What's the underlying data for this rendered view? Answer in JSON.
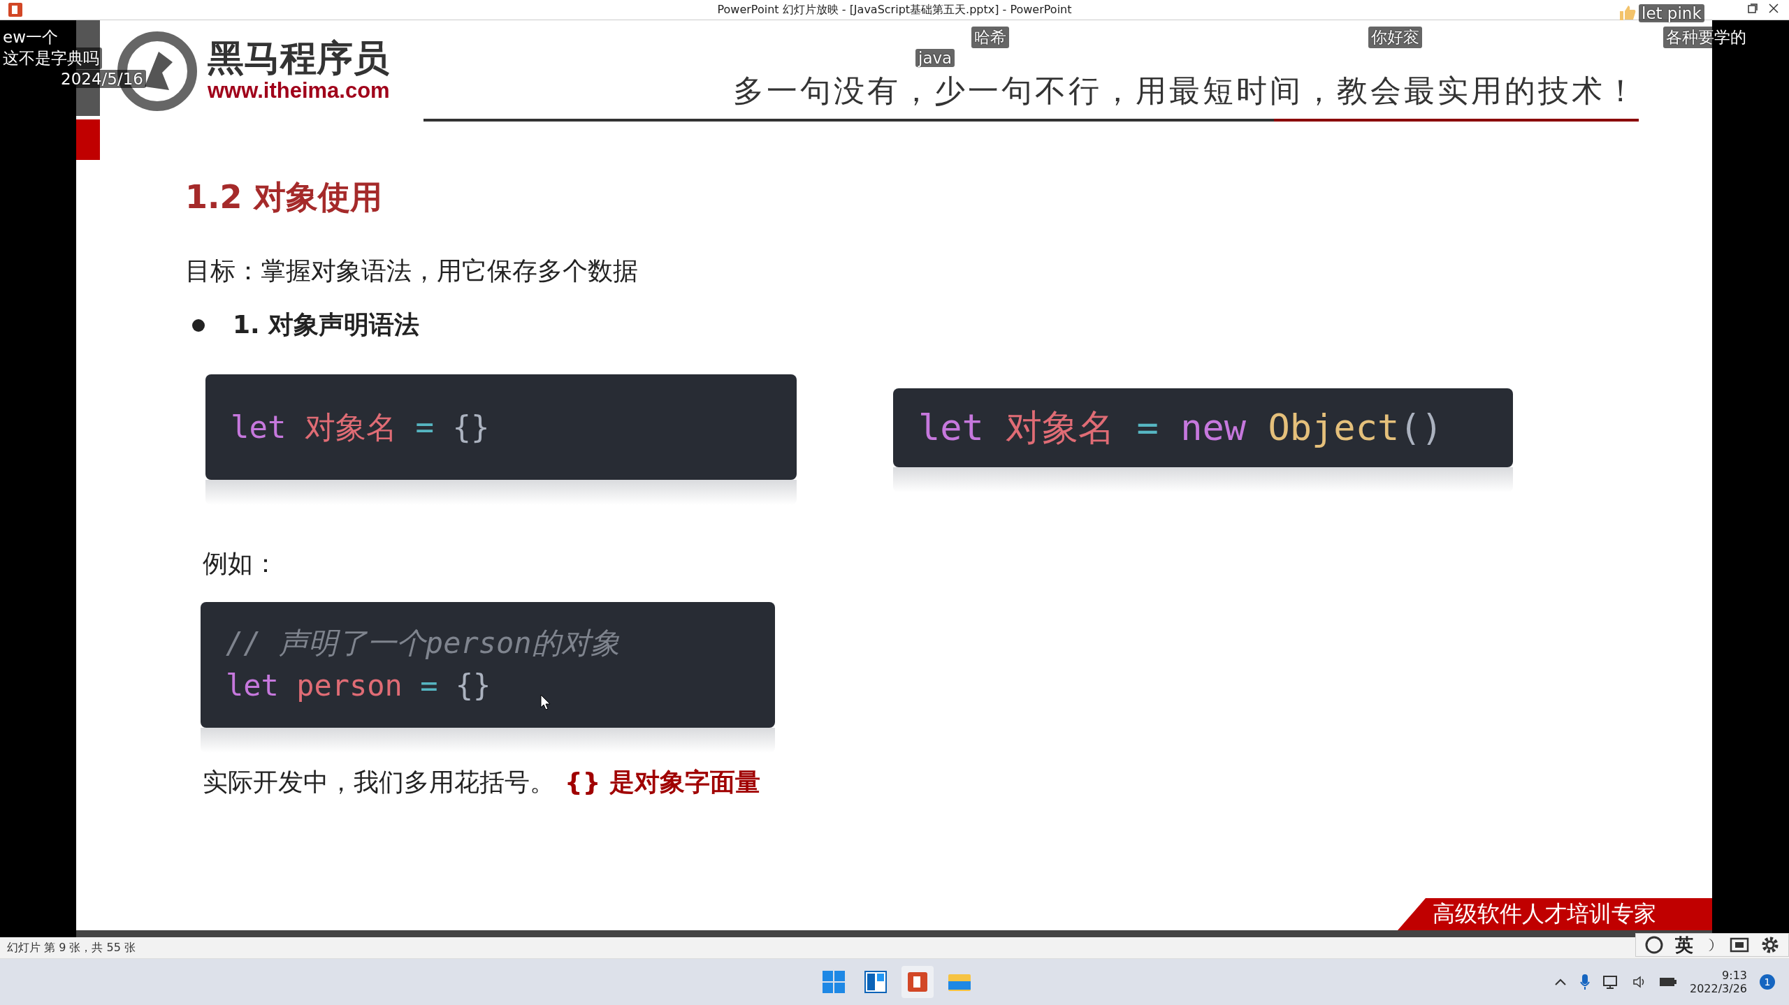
{
  "window": {
    "title": "PowerPoint 幻灯片放映 - [JavaScript基础第五天.pptx] - PowerPoint"
  },
  "danmaku": [
    {
      "text": "ew一个"
    },
    {
      "text": "这不是字典吗"
    },
    {
      "text": "2024/5/16"
    },
    {
      "text": "哈希"
    },
    {
      "text": "java"
    },
    {
      "text": "你好衮"
    },
    {
      "text": "各种要学的"
    },
    {
      "text": "let pink"
    }
  ],
  "slide": {
    "brand": {
      "name": "黑马程序员",
      "url": "www.itheima.com"
    },
    "slogan": "多一句没有，少一句不行，用最短时间，教会最实用的技术！",
    "heading": "1.2 对象使用",
    "goal": "目标：掌握对象语法，用它保存多个数据",
    "bullet": "1. 对象声明语法",
    "code_blocks": [
      {
        "lines": [
          [
            {
              "kind": "keyword",
              "text": "let"
            },
            {
              "kind": "variable",
              "text": " 对象名"
            },
            {
              "kind": "operator",
              "text": " ="
            },
            {
              "kind": "punct",
              "text": " {}"
            }
          ]
        ]
      },
      {
        "lines": [
          [
            {
              "kind": "keyword",
              "text": "let"
            },
            {
              "kind": "variable",
              "text": " 对象名"
            },
            {
              "kind": "operator",
              "text": " ="
            },
            {
              "kind": "keyword",
              "text": " new"
            },
            {
              "kind": "class",
              "text": " Object"
            },
            {
              "kind": "punct",
              "text": "()"
            }
          ]
        ]
      }
    ],
    "example_label": "例如：",
    "example_block": {
      "lines": [
        [
          {
            "kind": "comment",
            "text": "// 声明了一个person的对象"
          }
        ],
        [
          {
            "kind": "keyword",
            "text": "let"
          },
          {
            "kind": "variable",
            "text": " person"
          },
          {
            "kind": "operator",
            "text": " ="
          },
          {
            "kind": "punct",
            "text": " {}"
          }
        ]
      ]
    },
    "note": "实际开发中，我们多用花括号。",
    "note_highlight": "{} 是对象字面量",
    "banner": "高级软件人才培训专家"
  },
  "status_bar": "幻灯片 第 9 张，共 55 张",
  "ime": {
    "mode": "英"
  },
  "taskbar": {
    "time": "9:13",
    "date": "2022/3/26",
    "notifications": "1"
  }
}
